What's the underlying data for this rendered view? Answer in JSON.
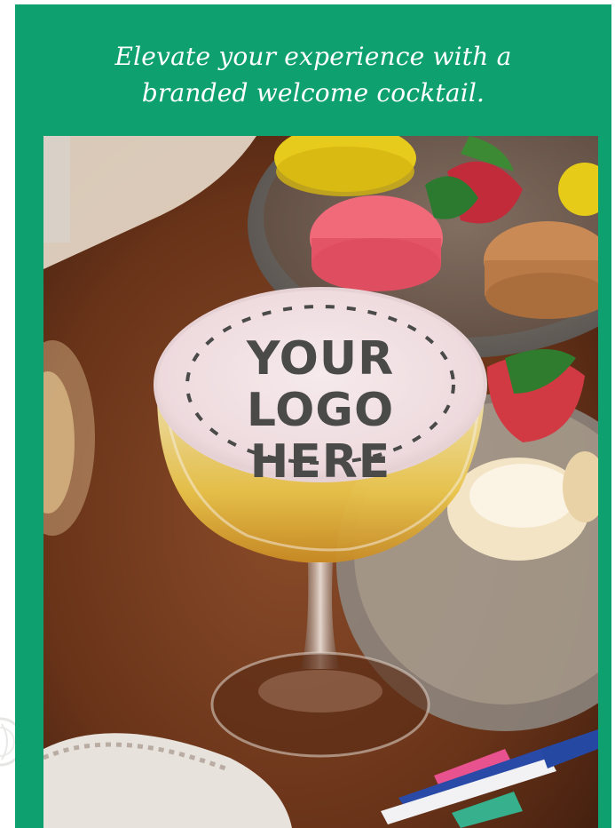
{
  "headline": {
    "line1": "Elevate your experience with a",
    "line2": "branded welcome cocktail."
  },
  "photo": {
    "logo_lines": [
      "YOUR",
      "LOGO",
      "HERE"
    ]
  },
  "colors": {
    "brand_green": "#0ea16f",
    "headline_text": "#ffffff",
    "foam": "#f2e4e6",
    "logo_text": "#4a4a48"
  }
}
